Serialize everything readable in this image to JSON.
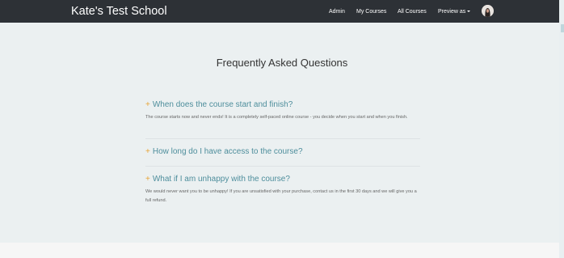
{
  "header": {
    "brand": "Kate's Test School",
    "nav": {
      "admin": "Admin",
      "my_courses": "My Courses",
      "all_courses": "All Courses",
      "preview_as": "Preview as"
    },
    "avatar_icon": "user-avatar"
  },
  "faq": {
    "title": "Frequently Asked Questions",
    "plus_icon": "+",
    "items": [
      {
        "question": "When does the course start and finish?",
        "answer": "The course starts now and never ends! It is a completely self-paced online course - you decide when you start and when you finish."
      },
      {
        "question": "How long do I have access to the course?",
        "answer": ""
      },
      {
        "question": "What if I am unhappy with the course?",
        "answer": "We would never want you to be unhappy! If you are unsatisfied with your purchase, contact us in the first 30 days and we will give you a full refund."
      }
    ]
  },
  "colors": {
    "navbar": "#2d3136",
    "question": "#4e8e9c",
    "accent_plus": "#e8a437",
    "background": "#ebf0f1"
  }
}
